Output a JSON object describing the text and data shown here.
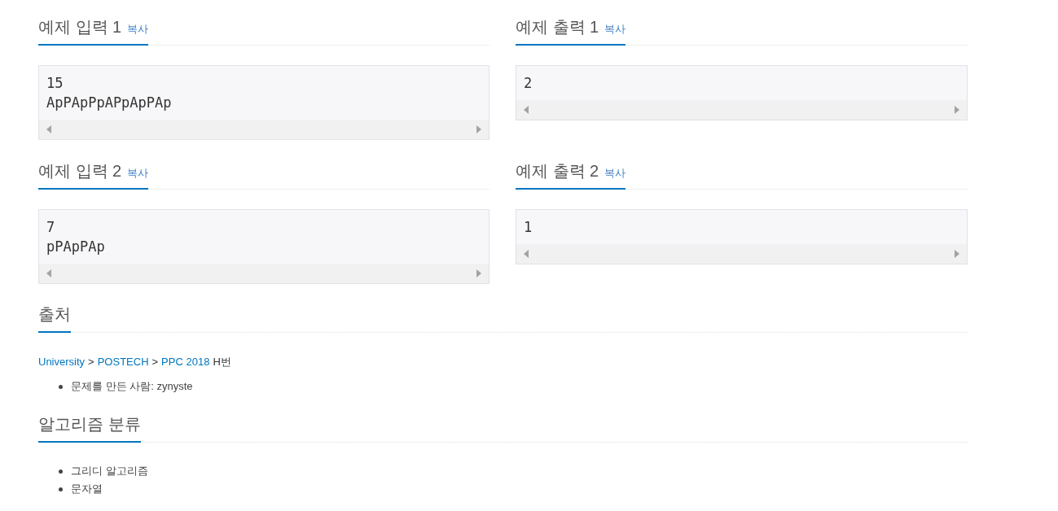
{
  "sample_rows": [
    {
      "input": {
        "title": "예제 입력 1",
        "copy_label": "복사",
        "lines": [
          "15",
          "ApPApPpAPpApPAp"
        ]
      },
      "output": {
        "title": "예제 출력 1",
        "copy_label": "복사",
        "lines": [
          "2"
        ]
      }
    },
    {
      "input": {
        "title": "예제 입력 2",
        "copy_label": "복사",
        "lines": [
          "7",
          "pPApPAp"
        ]
      },
      "output": {
        "title": "예제 출력 2",
        "copy_label": "복사",
        "lines": [
          "1"
        ]
      }
    }
  ],
  "source": {
    "title": "출처",
    "breadcrumb": [
      {
        "kind": "link",
        "text": "University"
      },
      {
        "kind": "separator",
        "text": ">"
      },
      {
        "kind": "link",
        "text": "POSTECH"
      },
      {
        "kind": "separator",
        "text": ">"
      },
      {
        "kind": "link",
        "text": "PPC 2018"
      },
      {
        "kind": "text",
        "text": "H번"
      }
    ],
    "details": [
      "문제를 만든 사람: zynyste"
    ]
  },
  "algorithm_tags": {
    "title": "알고리즘 분류",
    "items": [
      "그리디 알고리즘",
      "문자열"
    ]
  }
}
